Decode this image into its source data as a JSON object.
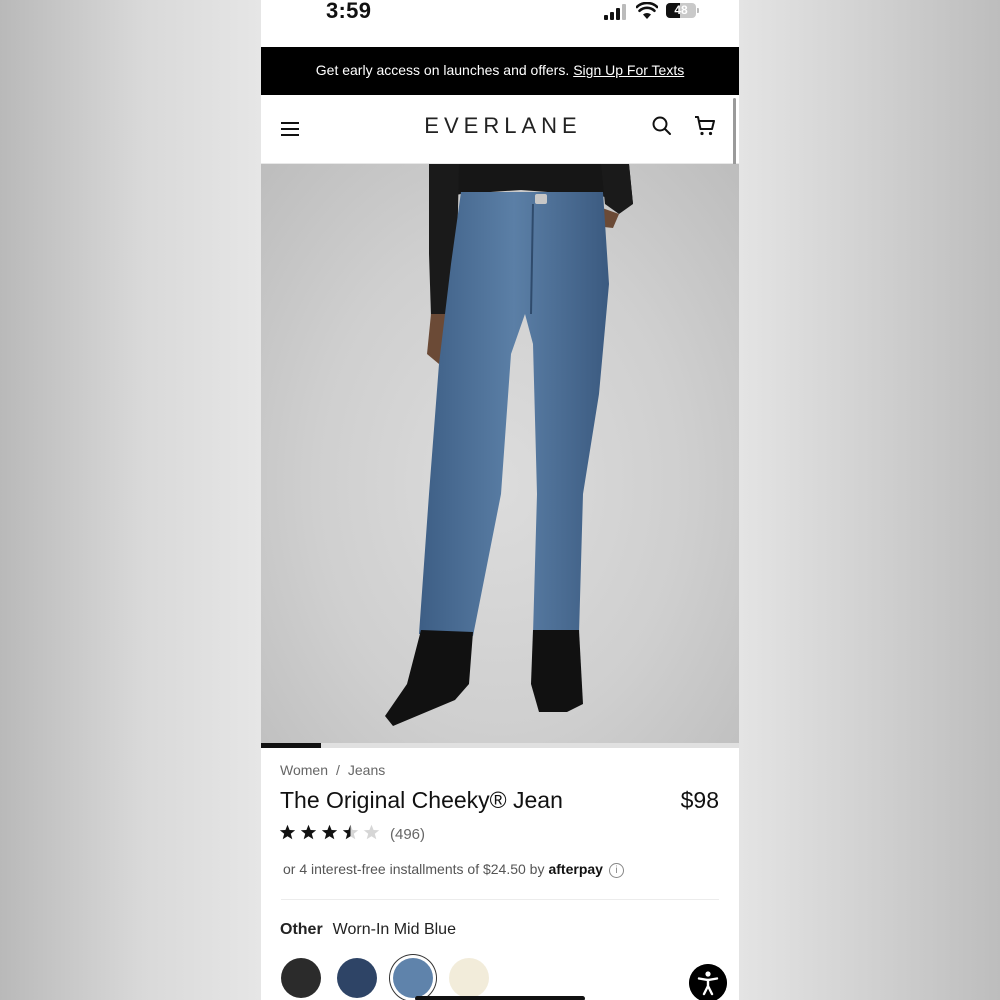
{
  "status_bar": {
    "time": "3:59",
    "battery": "48"
  },
  "promo": {
    "text": "Get early access on launches and offers.",
    "link": "Sign Up For Texts"
  },
  "nav": {
    "logo": "EVERLANE",
    "icons": [
      "menu-icon",
      "search-icon",
      "cart-icon"
    ]
  },
  "gallery": {
    "progress": 0.125
  },
  "breadcrumb": {
    "level1": "Women",
    "separator": "/",
    "level2": "Jeans"
  },
  "product": {
    "title": "The Original Cheeky® Jean",
    "price": "$98",
    "rating": 3.5,
    "rating_max": 5,
    "reviews": "(496)",
    "afterpay_text": "or 4 interest-free installments of $24.50 by",
    "afterpay_brand": "afterpay"
  },
  "color": {
    "label": "Other",
    "selected_name": "Worn-In Mid Blue",
    "swatches": [
      {
        "name": "black",
        "hex": "#2b2b2b"
      },
      {
        "name": "dark-blue",
        "hex": "#2e4466"
      },
      {
        "name": "worn-in-mid-blue",
        "hex": "#5f83ab",
        "selected": true
      },
      {
        "name": "ecru",
        "hex": "#f2ecda"
      }
    ]
  },
  "colors": {
    "promo_bg": "#000000",
    "text": "#111111",
    "muted": "#666666"
  }
}
